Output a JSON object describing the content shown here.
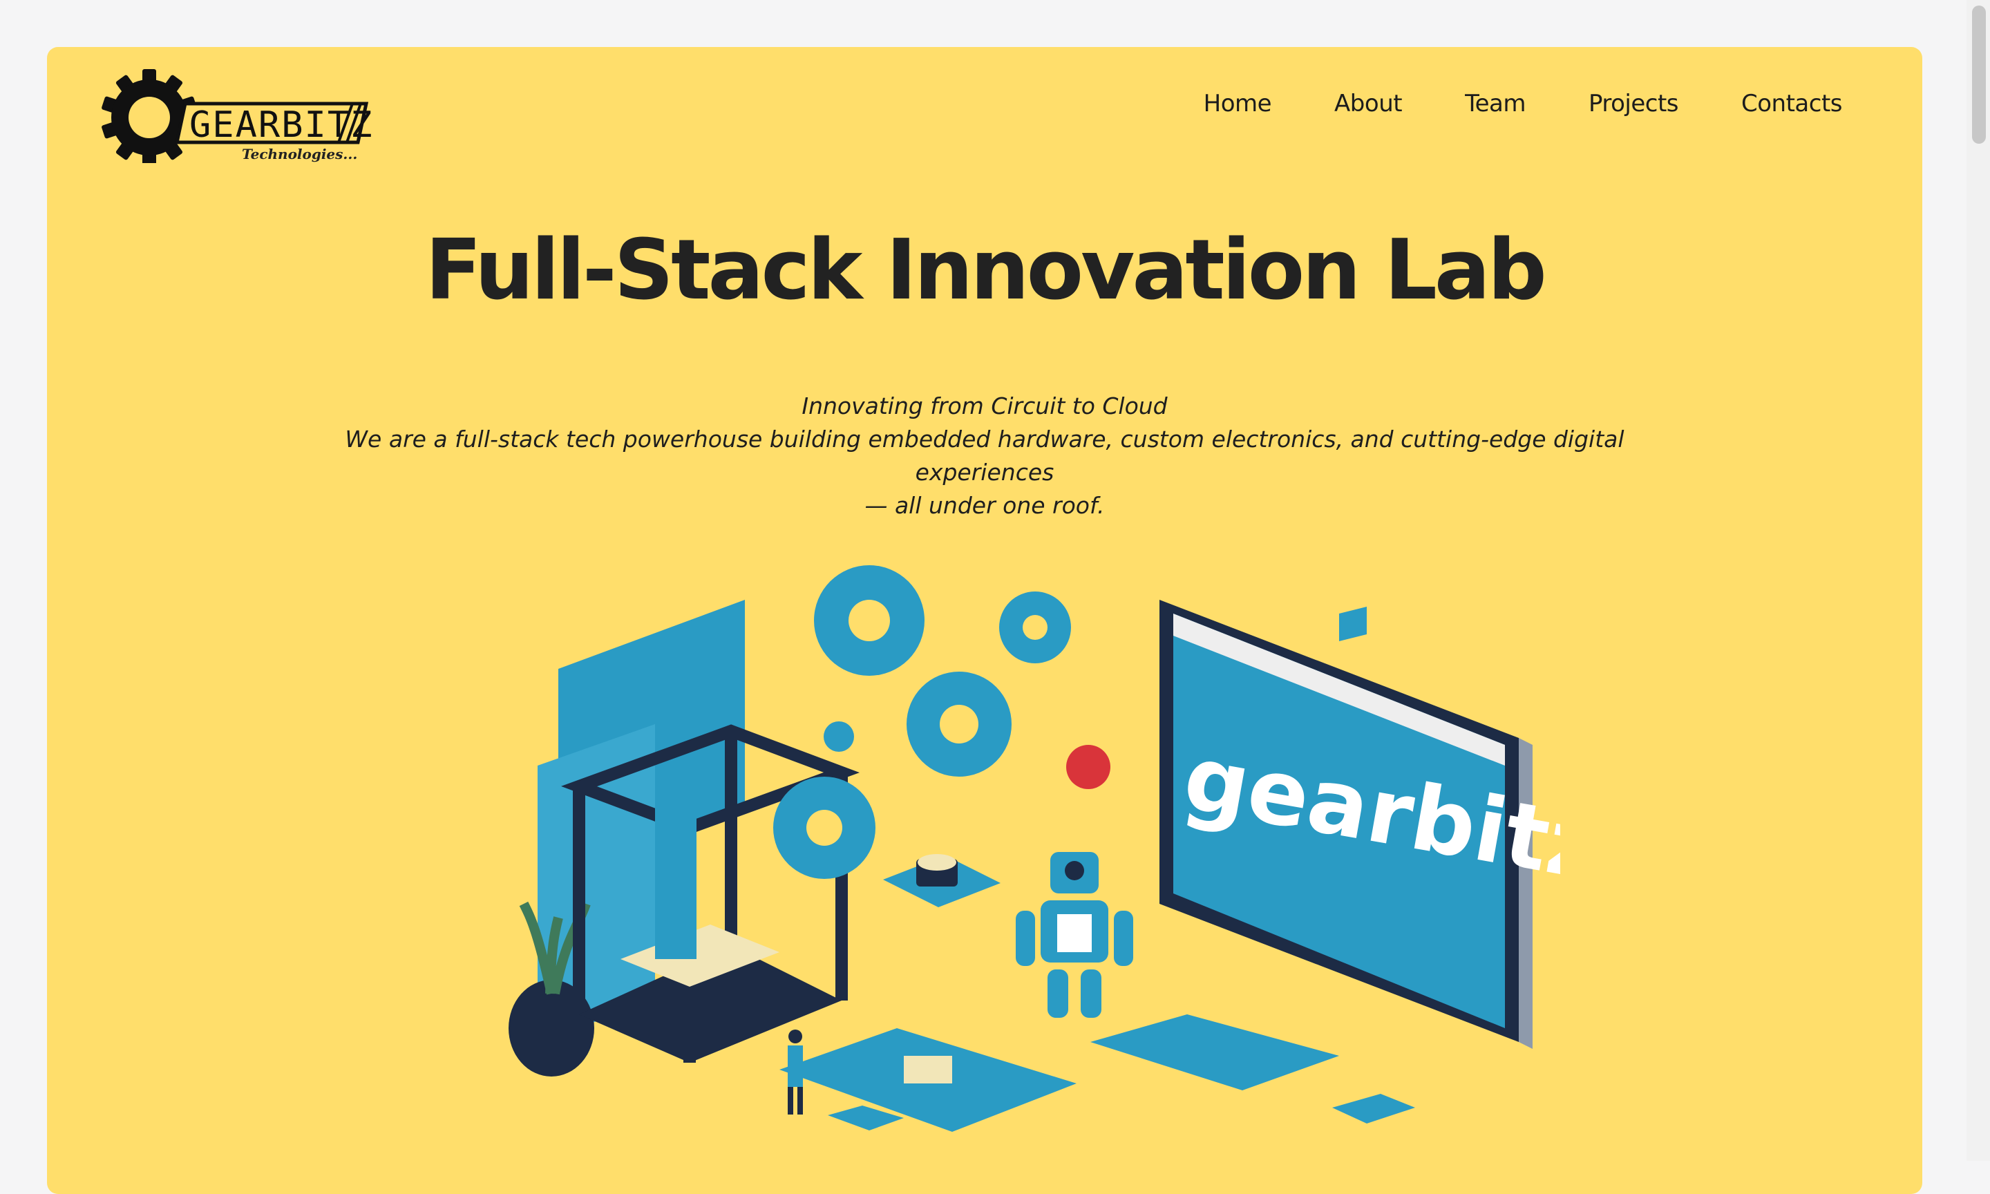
{
  "brand": {
    "logo_text": "GEARBITZ",
    "logo_tagline": "Technologies..."
  },
  "nav": {
    "items": [
      {
        "label": "Home"
      },
      {
        "label": "About"
      },
      {
        "label": "Team"
      },
      {
        "label": "Projects"
      },
      {
        "label": "Contacts"
      }
    ]
  },
  "hero": {
    "title": "Full-Stack Innovation Lab",
    "subtitle_line1": "Innovating from Circuit to Cloud",
    "subtitle_line2": "We are a full-stack tech powerhouse building embedded hardware, custom electronics, and cutting-edge digital experiences",
    "subtitle_line3": "— all under one roof.",
    "illustration_screen_text": "gearbitz"
  },
  "colors": {
    "card_background": "#ffde6b",
    "text_primary": "#222222",
    "illustration_teal": "#2a9bc4",
    "illustration_navy": "#1d2b45"
  },
  "icons": [
    "gear-icon"
  ]
}
